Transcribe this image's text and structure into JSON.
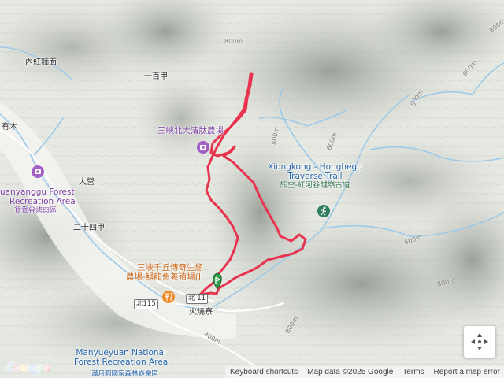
{
  "places": {
    "nei_hongpenmian": "內紅麵面",
    "youmu": "有木",
    "yibaijia": "一百甲",
    "daqingfu": "三峽北大清肽農場",
    "daying": "大營",
    "yuanyanggu_en": "uanyanggu Forest",
    "yuanyanggu_en2": "Recreation Area",
    "yuanyanggu_zh": "鴛鴦谷烤肉區",
    "ershisijia": "二十四甲",
    "qianqiu_1": "三峽千丘傳奇生態",
    "qianqiu_2": "農場-鱘龍魚養殖場(I",
    "huoshaoliao": "火燒寮",
    "xiongkong_en1": "Xiongkong - Honghegu",
    "xiongkong_en2": "Traverse Trail",
    "xiongkong_zh": "熊空-紅河谷越嶺古道",
    "manyueyuan_en1": "Manyueyuan National",
    "manyueyuan_en2": "Forest Recreation Area",
    "manyueyuan_zh": "滿月圓國家森林遊樂區"
  },
  "roads": {
    "bei115": "北115",
    "bei_shield": "北 11"
  },
  "contours": [
    "800m",
    "800m",
    "600m",
    "600m",
    "800m",
    "800m",
    "800m",
    "400m",
    "800m",
    "600m"
  ],
  "logo": "Google",
  "attribution": {
    "shortcuts": "Keyboard shortcuts",
    "data": "Map data ©2025 Google",
    "terms": "Terms",
    "report": "Report a map error"
  },
  "icons": {
    "fullscreen": "fullscreen-icon",
    "navigation": "pan-navigation-icon",
    "start_marker": "start-pin-icon",
    "attraction": "camera-poi-icon",
    "restaurant": "fork-knife-icon",
    "trail": "hiking-trail-icon"
  },
  "colors": {
    "track": "#e8344f",
    "water": "#9ec9e8",
    "terrain_light": "#eef1ec",
    "terrain_dark": "#b9bfb8"
  }
}
